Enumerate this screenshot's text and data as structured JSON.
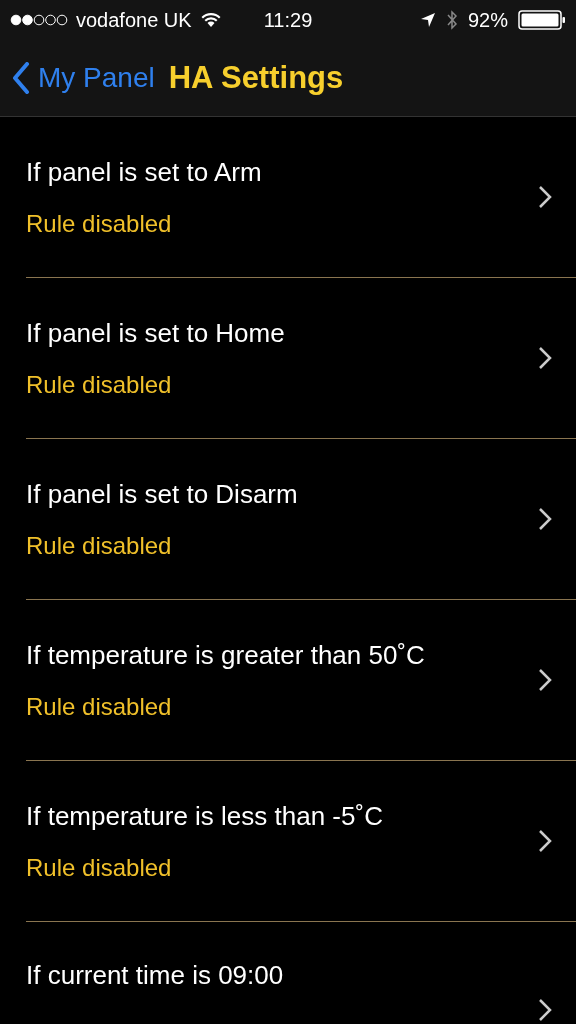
{
  "status_bar": {
    "carrier": "vodafone UK",
    "time": "11:29",
    "battery": "92%"
  },
  "nav": {
    "back": "My Panel",
    "title": "HA Settings"
  },
  "rules": [
    {
      "title": "If panel is set to Arm",
      "status": "Rule disabled"
    },
    {
      "title": "If panel is set to Home",
      "status": "Rule disabled"
    },
    {
      "title": "If panel is set to Disarm",
      "status": "Rule disabled"
    },
    {
      "title": "If temperature is greater than 50˚C",
      "status": "Rule disabled"
    },
    {
      "title": "If temperature is less than -5˚C",
      "status": "Rule disabled"
    },
    {
      "title": "If current time is 09:00"
    }
  ]
}
